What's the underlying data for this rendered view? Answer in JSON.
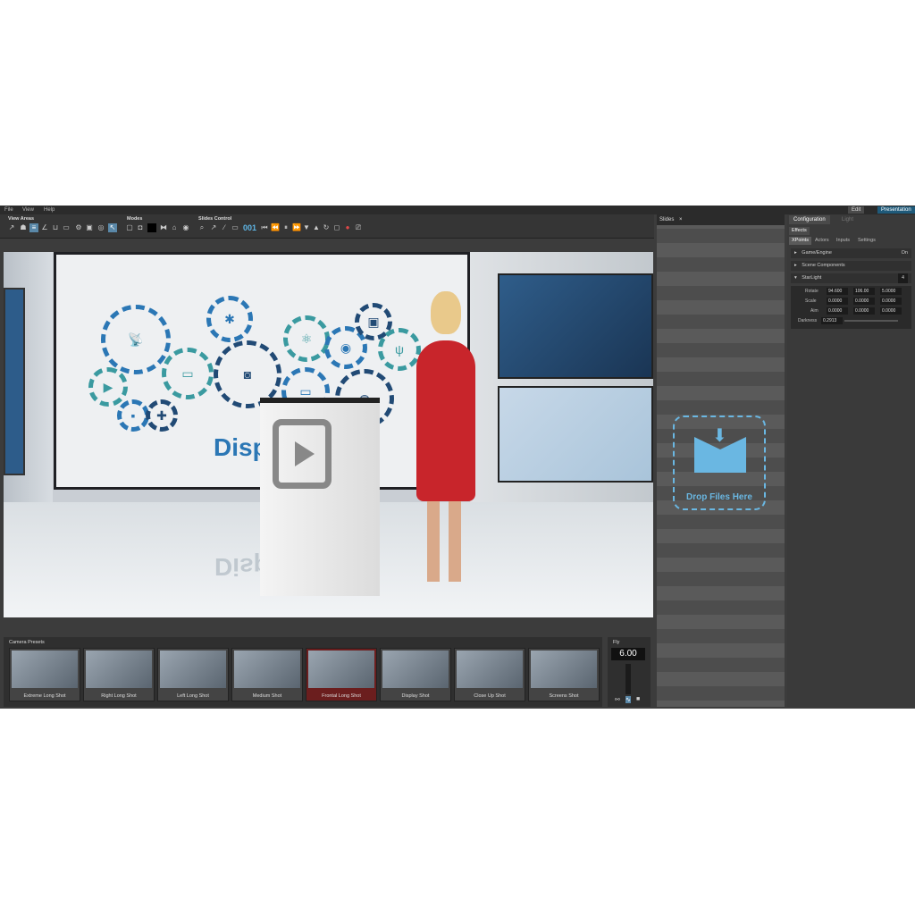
{
  "menu": [
    "File",
    "View",
    "Help"
  ],
  "modes_buttons": {
    "edit": "Edit",
    "presentation": "Presentation"
  },
  "toolbar": {
    "view_areas_label": "View Areas",
    "modes_label": "Modes",
    "slides_control_label": "Slides Control",
    "slide_number": "001"
  },
  "viewport": {
    "screen_word": "Disp",
    "floor_reflection": "Disp"
  },
  "camera_presets": {
    "label": "Camera Presets",
    "items": [
      {
        "label": "Extreme Long Shot"
      },
      {
        "label": "Right Long Shot"
      },
      {
        "label": "Left Long Shot"
      },
      {
        "label": "Medium Shot"
      },
      {
        "label": "Frontal Long Shot"
      },
      {
        "label": "Display Shot"
      },
      {
        "label": "Close Up Shot"
      },
      {
        "label": "Screens Shot"
      }
    ],
    "active_index": 4
  },
  "fly": {
    "label": "Fly",
    "value": "6.00"
  },
  "slides": {
    "tab_label": "Slides",
    "drop_text": "Drop Files Here"
  },
  "config": {
    "tabs": [
      "Configuration",
      "Light"
    ],
    "effects_label": "Effects",
    "subtabs": [
      "XPoints",
      "Actors",
      "Inputs",
      "Settings"
    ],
    "rows": {
      "game_engine": "Game/Engine",
      "game_engine_state": "On",
      "scene_components": "Scene Components",
      "starlight": "StarLight",
      "starlight_value": "4"
    },
    "rotate": {
      "label": "Rotate",
      "x": "94.600",
      "y": "106.00",
      "z": "5.0000"
    },
    "scale": {
      "label": "Scale",
      "x": "0.0000",
      "y": "0.0000",
      "z": "0.0000"
    },
    "aim": {
      "label": "Aim",
      "x": "0.0000",
      "y": "0.0000",
      "z": "0.0000"
    },
    "darkness": {
      "label": "Darkness",
      "value": "0.2913"
    }
  },
  "colors": {
    "accent": "#6ab7e2",
    "dress": "#c8252b",
    "brand_blue": "#2b77b5"
  }
}
